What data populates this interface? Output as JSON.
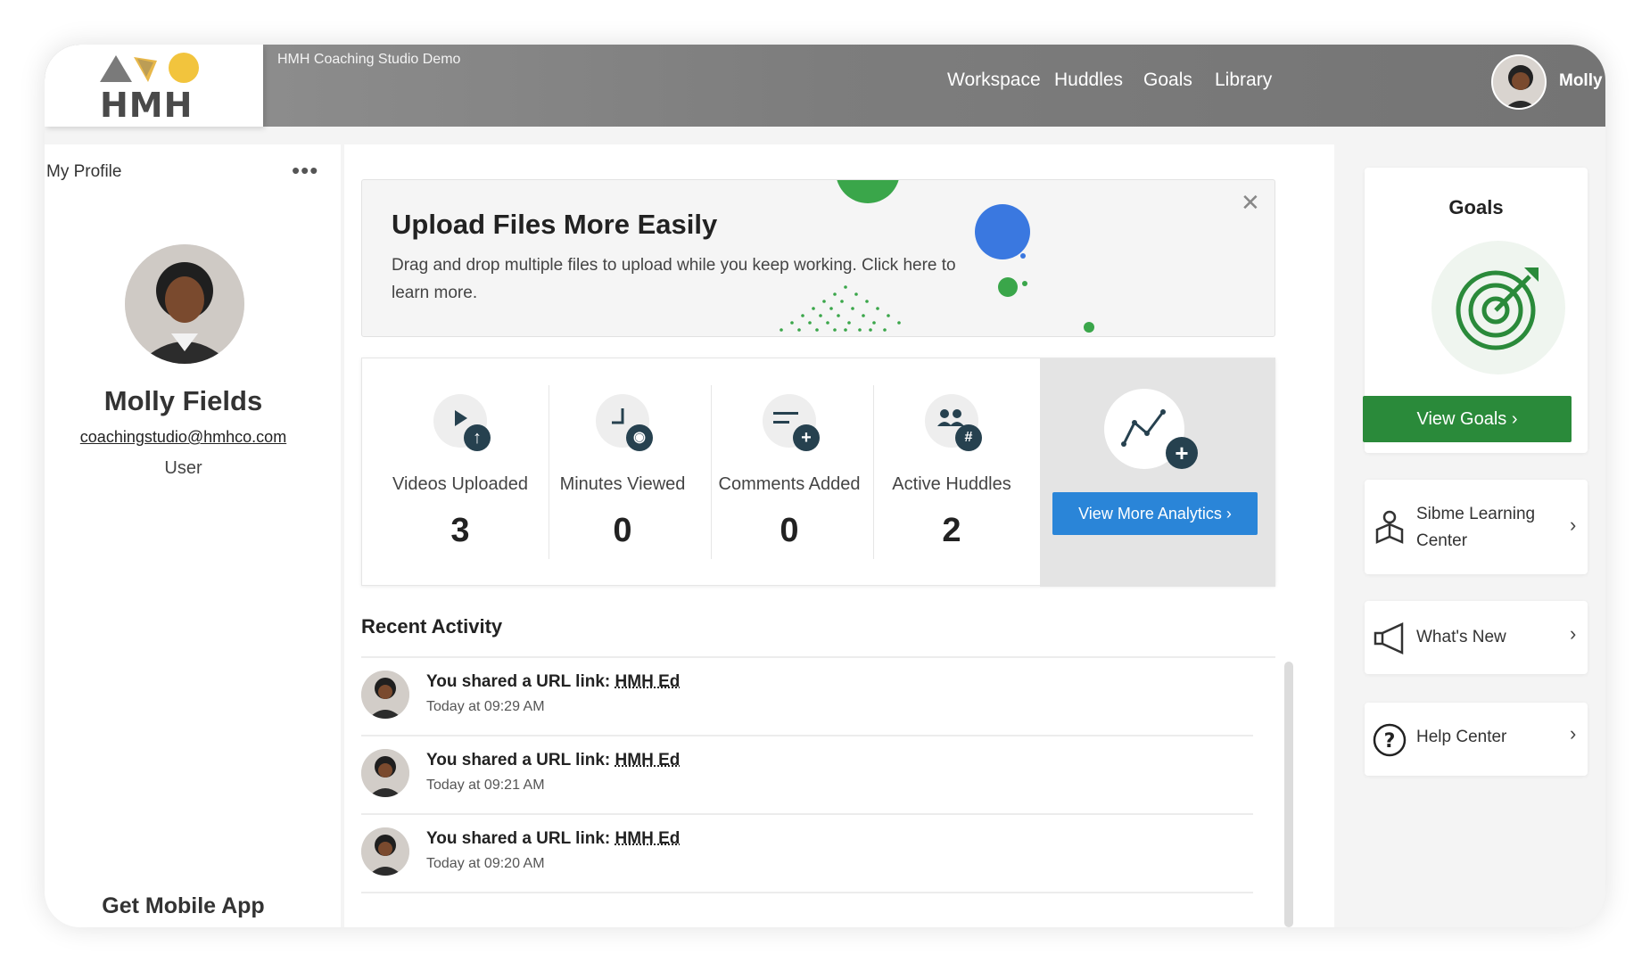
{
  "app": {
    "logo_text": "HMH",
    "title": "HMH Coaching Studio Demo"
  },
  "nav": {
    "items": [
      {
        "label": "Workspace"
      },
      {
        "label": "Huddles"
      },
      {
        "label": "Goals"
      },
      {
        "label": "Library"
      }
    ],
    "user_name": "Molly"
  },
  "profile": {
    "section_label": "My Profile",
    "menu_icon": "more-dots-icon",
    "name": "Molly Fields",
    "email": "coachingstudio@hmhco.com",
    "role": "User",
    "mobile_app_label": "Get Mobile App"
  },
  "banner": {
    "title": "Upload Files More Easily",
    "text": "Drag and drop multiple files to upload while you keep working. Click here to learn more.",
    "colors": {
      "green": "#3aa64a",
      "blue": "#3a78e0"
    }
  },
  "stats": [
    {
      "label": "Videos Uploaded",
      "value": "3",
      "icon": "video-play-icon",
      "badge": "↑"
    },
    {
      "label": "Minutes Viewed",
      "value": "0",
      "icon": "minutes-icon",
      "badge": "◉"
    },
    {
      "label": "Comments Added",
      "value": "0",
      "icon": "comment-icon",
      "badge": "+"
    },
    {
      "label": "Active Huddles",
      "value": "2",
      "icon": "huddle-people-icon",
      "badge": "#"
    }
  ],
  "analytics": {
    "button_label": "View More Analytics ›",
    "icon": "line-chart-icon"
  },
  "recent": {
    "title": "Recent Activity",
    "items": [
      {
        "prefix": "You shared a URL link: ",
        "link": "HMH Ed",
        "time": "Today at 09:29 AM"
      },
      {
        "prefix": "You shared a URL link: ",
        "link": "HMH Ed",
        "time": "Today at 09:21 AM"
      },
      {
        "prefix": "You shared a URL link: ",
        "link": "HMH Ed",
        "time": "Today at 09:20 AM"
      }
    ]
  },
  "goals": {
    "title": "Goals",
    "button_label": "View Goals ›",
    "accent": "#2a8a3a"
  },
  "links": [
    {
      "label": "Sibme Learning Center",
      "icon": "learning-center-icon"
    },
    {
      "label": "What's New",
      "icon": "megaphone-icon"
    },
    {
      "label": "Help Center",
      "icon": "help-question-icon"
    }
  ]
}
